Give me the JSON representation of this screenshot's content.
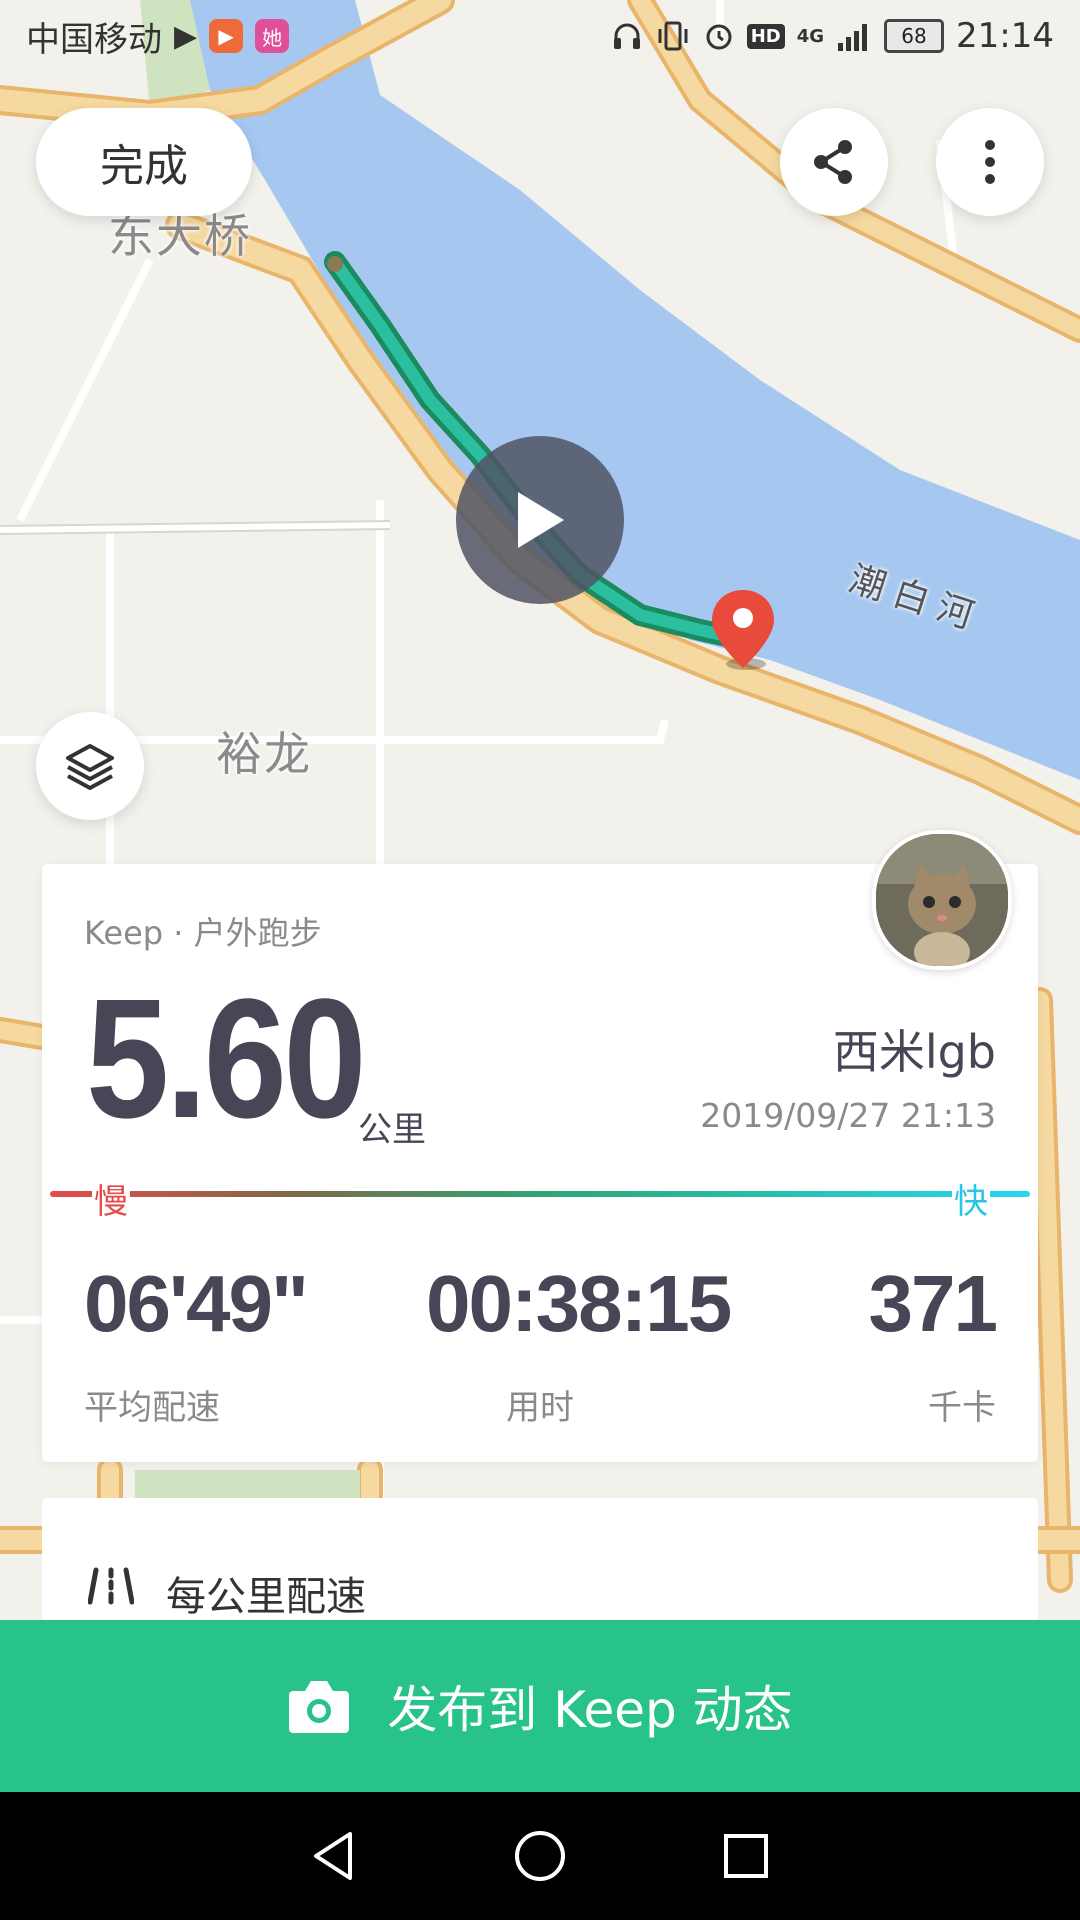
{
  "status_bar": {
    "carrier": "中国移动",
    "battery": "68",
    "time": "21:14",
    "network": "4G",
    "hd": "HD",
    "app_badge_1": "▶",
    "app_badge_2": "她",
    "icons": [
      "play-icon",
      "video-app-icon",
      "she-app-icon",
      "headphones-icon",
      "vibrate-icon",
      "alarm-icon",
      "hd-icon",
      "signal-icon",
      "battery-icon"
    ]
  },
  "map": {
    "labels": {
      "bridge": "东大桥",
      "district": "裕龙",
      "river": "潮白河"
    },
    "colors": {
      "land": "#f3f1ec",
      "water": "#a6c8f0",
      "road": "#f6d9a0",
      "road_border": "#e8b56a",
      "route": "#2bbfa0",
      "route_dark": "#1b8a5e",
      "pin": "#e84a3c"
    }
  },
  "toolbar": {
    "done_label": "完成",
    "share_icon": "share-icon",
    "more_icon": "more-vertical-icon",
    "layers_icon": "layers-icon",
    "play_icon": "play-icon"
  },
  "summary": {
    "activity_type": "Keep · 户外跑步",
    "distance": "5.60",
    "distance_unit": "公里",
    "user_name": "西米lgb",
    "timestamp": "2019/09/27 21:13",
    "pace_slow_label": "慢",
    "pace_fast_label": "快",
    "stats": [
      {
        "value": "06'49\"",
        "label": "平均配速"
      },
      {
        "value": "00:38:15",
        "label": "用时"
      },
      {
        "value": "371",
        "label": "千卡"
      }
    ]
  },
  "splits": {
    "title": "每公里配速"
  },
  "share_bar": {
    "label": "发布到 Keep 动态",
    "color": "#27c38a"
  },
  "nav_bar": {
    "icons": [
      "back-icon",
      "home-icon",
      "recents-icon"
    ]
  }
}
